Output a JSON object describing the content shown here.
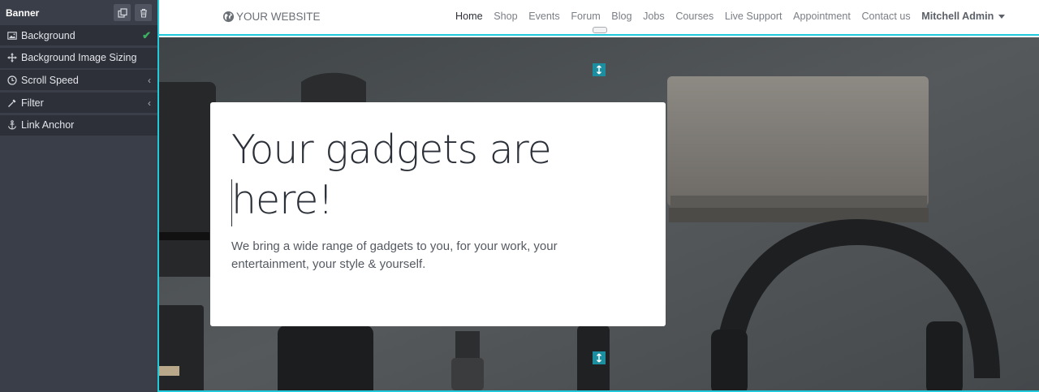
{
  "sidebar": {
    "title": "Banner",
    "options": [
      {
        "label": "Background",
        "icon": "image-icon",
        "state": "check"
      },
      {
        "label": "Background Image Sizing",
        "icon": "move-icon",
        "state": ""
      },
      {
        "label": "Scroll Speed",
        "icon": "clock-icon",
        "state": "chevron"
      },
      {
        "label": "Filter",
        "icon": "eyedropper-icon",
        "state": "chevron"
      },
      {
        "label": "Link Anchor",
        "icon": "anchor-icon",
        "state": ""
      }
    ]
  },
  "site": {
    "brand": "YOUR WEBSITE",
    "nav": [
      "Home",
      "Shop",
      "Events",
      "Forum",
      "Blog",
      "Jobs",
      "Courses",
      "Live Support",
      "Appointment",
      "Contact us"
    ],
    "active_nav": "Home",
    "user": "Mitchell Admin"
  },
  "banner": {
    "headline_line1": "Your gadgets are",
    "headline_line2": "here!",
    "lead": "We bring a wide range of gadgets to you, for your work, your entertainment, your style & yourself."
  },
  "colors": {
    "accent": "#22c9da",
    "sidebar_bg": "#3a3e48",
    "check": "#3bb062",
    "handle": "#1b8fa0"
  }
}
